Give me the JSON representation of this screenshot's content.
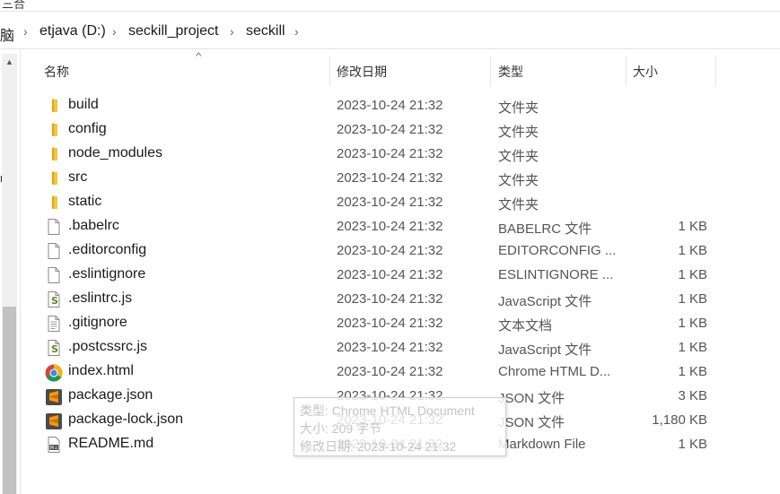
{
  "top_fragment": "三合",
  "left_fragment": "n",
  "breadcrumb": [
    "脑",
    "etjava (D:)",
    "seckill_project",
    "seckill"
  ],
  "columns": {
    "name": "名称",
    "modified": "修改日期",
    "type": "类型",
    "size": "大小"
  },
  "files": [
    {
      "name": "build",
      "date": "2023-10-24 21:32",
      "type": "文件夹",
      "size": "",
      "icon": "folder-icon"
    },
    {
      "name": "config",
      "date": "2023-10-24 21:32",
      "type": "文件夹",
      "size": "",
      "icon": "folder-icon"
    },
    {
      "name": "node_modules",
      "date": "2023-10-24 21:32",
      "type": "文件夹",
      "size": "",
      "icon": "folder-icon"
    },
    {
      "name": "src",
      "date": "2023-10-24 21:32",
      "type": "文件夹",
      "size": "",
      "icon": "folder-icon"
    },
    {
      "name": "static",
      "date": "2023-10-24 21:32",
      "type": "文件夹",
      "size": "",
      "icon": "folder-icon"
    },
    {
      "name": ".babelrc",
      "date": "2023-10-24 21:32",
      "type": "BABELRC 文件",
      "size": "1 KB",
      "icon": "file-icon"
    },
    {
      "name": ".editorconfig",
      "date": "2023-10-24 21:32",
      "type": "EDITORCONFIG ...",
      "size": "1 KB",
      "icon": "file-icon"
    },
    {
      "name": ".eslintignore",
      "date": "2023-10-24 21:32",
      "type": "ESLINTIGNORE ...",
      "size": "1 KB",
      "icon": "file-icon"
    },
    {
      "name": ".eslintrc.js",
      "date": "2023-10-24 21:32",
      "type": "JavaScript 文件",
      "size": "1 KB",
      "icon": "js-file-icon"
    },
    {
      "name": ".gitignore",
      "date": "2023-10-24 21:32",
      "type": "文本文档",
      "size": "1 KB",
      "icon": "text-file-icon"
    },
    {
      "name": ".postcssrc.js",
      "date": "2023-10-24 21:32",
      "type": "JavaScript 文件",
      "size": "1 KB",
      "icon": "js-file-icon"
    },
    {
      "name": "index.html",
      "date": "2023-10-24 21:32",
      "type": "Chrome HTML D...",
      "size": "1 KB",
      "icon": "chrome-icon"
    },
    {
      "name": "package.json",
      "date": "2023-10-24 21:32",
      "type": "JSON 文件",
      "size": "3 KB",
      "icon": "sublime-icon"
    },
    {
      "name": "package-lock.json",
      "date": "2023-10-24 21:32",
      "type": "JSON 文件",
      "size": "1,180 KB",
      "icon": "sublime-icon"
    },
    {
      "name": "README.md",
      "date": "2023-10-24 21:32",
      "type": "Markdown File",
      "size": "1 KB",
      "icon": "markdown-icon"
    }
  ],
  "tooltip": {
    "type_line": "类型: Chrome HTML Document",
    "size_line": "大小: 209 字节",
    "date_line": "修改日期: 2023-10-24 21:32"
  },
  "colors": {
    "folder": "#f5c542",
    "scroll_thumb": "#c2c2c2",
    "sublime": "#ff9800"
  }
}
